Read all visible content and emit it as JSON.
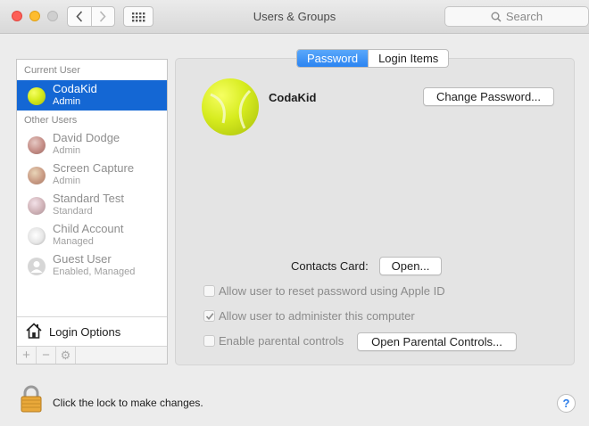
{
  "window": {
    "title": "Users & Groups",
    "search_placeholder": "Search"
  },
  "sidebar": {
    "current_user_header": "Current User",
    "current_user": {
      "name": "CodaKid",
      "role": "Admin"
    },
    "other_users_header": "Other Users",
    "other_users": [
      {
        "name": "David Dodge",
        "role": "Admin"
      },
      {
        "name": "Screen Capture",
        "role": "Admin"
      },
      {
        "name": "Standard Test",
        "role": "Standard"
      },
      {
        "name": "Child Account",
        "role": "Managed"
      },
      {
        "name": "Guest User",
        "role": "Enabled, Managed"
      }
    ],
    "login_options_label": "Login Options",
    "bottom_buttons": [
      "+",
      "−",
      "⚙"
    ]
  },
  "tabs": [
    {
      "label": "Password",
      "active": true
    },
    {
      "label": "Login Items",
      "active": false
    }
  ],
  "user_detail": {
    "name": "CodaKid",
    "change_password_label": "Change Password...",
    "contacts_card_label": "Contacts Card:",
    "open_button_label": "Open...",
    "options": [
      {
        "label": "Allow user to reset password using Apple ID",
        "checked": false
      },
      {
        "label": "Allow user to administer this computer",
        "checked": true
      },
      {
        "label": "Enable parental controls",
        "checked": false
      }
    ],
    "open_parental_controls_label": "Open Parental Controls..."
  },
  "footer": {
    "lock_text": "Click the lock to make changes.",
    "help_label": "?"
  },
  "colors": {
    "selection": "#1467d4",
    "tab_active": "#2b84f1",
    "close": "#fd5f57",
    "minimize": "#febc2e"
  },
  "icons": [
    "back-chevron-icon",
    "forward-chevron-icon",
    "grid-icon",
    "search-icon",
    "house-icon",
    "gear-icon",
    "lock-icon",
    "checkmark-icon",
    "help-icon"
  ]
}
